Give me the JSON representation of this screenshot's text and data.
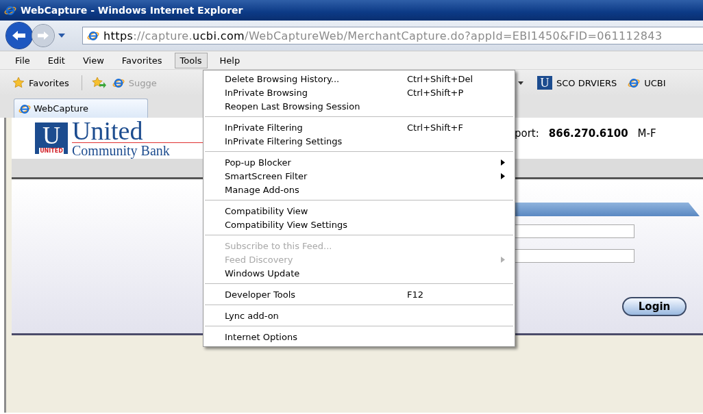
{
  "window": {
    "title": "WebCapture - Windows Internet Explorer"
  },
  "address_bar": {
    "url_parts": [
      {
        "text": "https",
        "emphasis": true
      },
      {
        "text": "://capture.",
        "emphasis": false
      },
      {
        "text": "ucbi.com",
        "emphasis": true
      },
      {
        "text": "/WebCaptureWeb/MerchantCapture.do?appId=EBI1450&FID=061112843",
        "emphasis": false
      }
    ]
  },
  "menu_bar": [
    {
      "label": "File",
      "selected": false
    },
    {
      "label": "Edit",
      "selected": false
    },
    {
      "label": "View",
      "selected": false
    },
    {
      "label": "Favorites",
      "selected": false
    },
    {
      "label": "Tools",
      "selected": true
    },
    {
      "label": "Help",
      "selected": false
    }
  ],
  "favorites_bar": {
    "favorites_button": "Favorites",
    "suggested": "Sugge",
    "links": [
      {
        "kind": "bank",
        "icon_letter": "U",
        "label": "SCO DRVIERS"
      },
      {
        "kind": "page",
        "label": "UCBI"
      }
    ]
  },
  "tabs": [
    {
      "label": "WebCapture",
      "selected": true
    }
  ],
  "page": {
    "logo": {
      "letter": "U",
      "badge": "UNITED",
      "name": "United",
      "subname": "Community Bank"
    },
    "support_label": "port:",
    "phone": "866.270.6100",
    "hours": "M-F",
    "login_button": "Login"
  },
  "tools_menu": [
    [
      {
        "label": "Delete Browsing History...",
        "shortcut": "Ctrl+Shift+Del",
        "submenu": false,
        "disabled": false
      },
      {
        "label": "InPrivate Browsing",
        "shortcut": "Ctrl+Shift+P",
        "submenu": false,
        "disabled": false
      },
      {
        "label": "Reopen Last Browsing Session",
        "submenu": false,
        "disabled": false
      }
    ],
    [
      {
        "label": "InPrivate Filtering",
        "shortcut": "Ctrl+Shift+F",
        "submenu": false,
        "disabled": false
      },
      {
        "label": "InPrivate Filtering Settings",
        "submenu": false,
        "disabled": false
      }
    ],
    [
      {
        "label": "Pop-up Blocker",
        "submenu": true,
        "disabled": false
      },
      {
        "label": "SmartScreen Filter",
        "submenu": true,
        "disabled": false
      },
      {
        "label": "Manage Add-ons",
        "submenu": false,
        "disabled": false
      }
    ],
    [
      {
        "label": "Compatibility View",
        "submenu": false,
        "disabled": false
      },
      {
        "label": "Compatibility View Settings",
        "submenu": false,
        "disabled": false
      }
    ],
    [
      {
        "label": "Subscribe to this Feed...",
        "submenu": false,
        "disabled": true
      },
      {
        "label": "Feed Discovery",
        "submenu": true,
        "disabled": true
      },
      {
        "label": "Windows Update",
        "submenu": false,
        "disabled": false
      }
    ],
    [
      {
        "label": "Developer Tools",
        "shortcut": "F12",
        "submenu": false,
        "disabled": false
      }
    ],
    [
      {
        "label": "Lync add-on",
        "submenu": false,
        "disabled": false
      }
    ],
    [
      {
        "label": "Internet Options",
        "submenu": false,
        "disabled": false
      }
    ]
  ]
}
